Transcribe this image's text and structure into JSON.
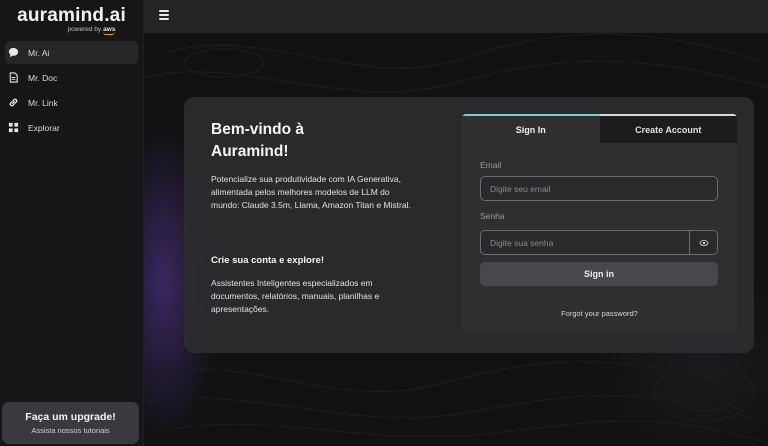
{
  "brand": {
    "name": "auramind.ai",
    "powered_by": "powered by",
    "partner": "aws"
  },
  "sidebar": {
    "items": [
      {
        "label": "Mr. Ai",
        "icon": "chat-bubble-icon",
        "active": true
      },
      {
        "label": "Mr. Doc",
        "icon": "document-icon",
        "active": false
      },
      {
        "label": "Mr. Link",
        "icon": "link-icon",
        "active": false
      },
      {
        "label": "Explorar",
        "icon": "grid-icon",
        "active": false
      }
    ],
    "upgrade": {
      "title": "Faça um upgrade!",
      "subtitle": "Assista nossos tutoriais"
    }
  },
  "topbar": {
    "menu_icon": "hamburger-menu-icon"
  },
  "welcome": {
    "title": "Bem-vindo à Auramind!",
    "description": "Potencialize sua produtividade com IA Generativa, alimentada pelos melhores modelos de LLM do mundo: Claude 3.5m, Llama, Amazon Titan e Mistral.",
    "cta_title": "Crie sua conta e explore!",
    "cta_description": "Assistentes Inteligentes especializados em documentos, relatórios, manuais, planilhas e apresentações."
  },
  "auth": {
    "tabs": [
      {
        "label": "Sign In",
        "active": true
      },
      {
        "label": "Create Account",
        "active": false
      }
    ],
    "email_label": "Email",
    "email_placeholder": "Digite seu email",
    "email_value": "",
    "password_label": "Senha",
    "password_placeholder": "Digite sua senha",
    "password_value": "",
    "submit_label": "Sign in",
    "forgot_label": "Forgot your password?"
  },
  "colors": {
    "accent_tab": "#6fd1c9",
    "aws_orange": "#f29b1d",
    "glow_purple": "#5c3aa0"
  }
}
